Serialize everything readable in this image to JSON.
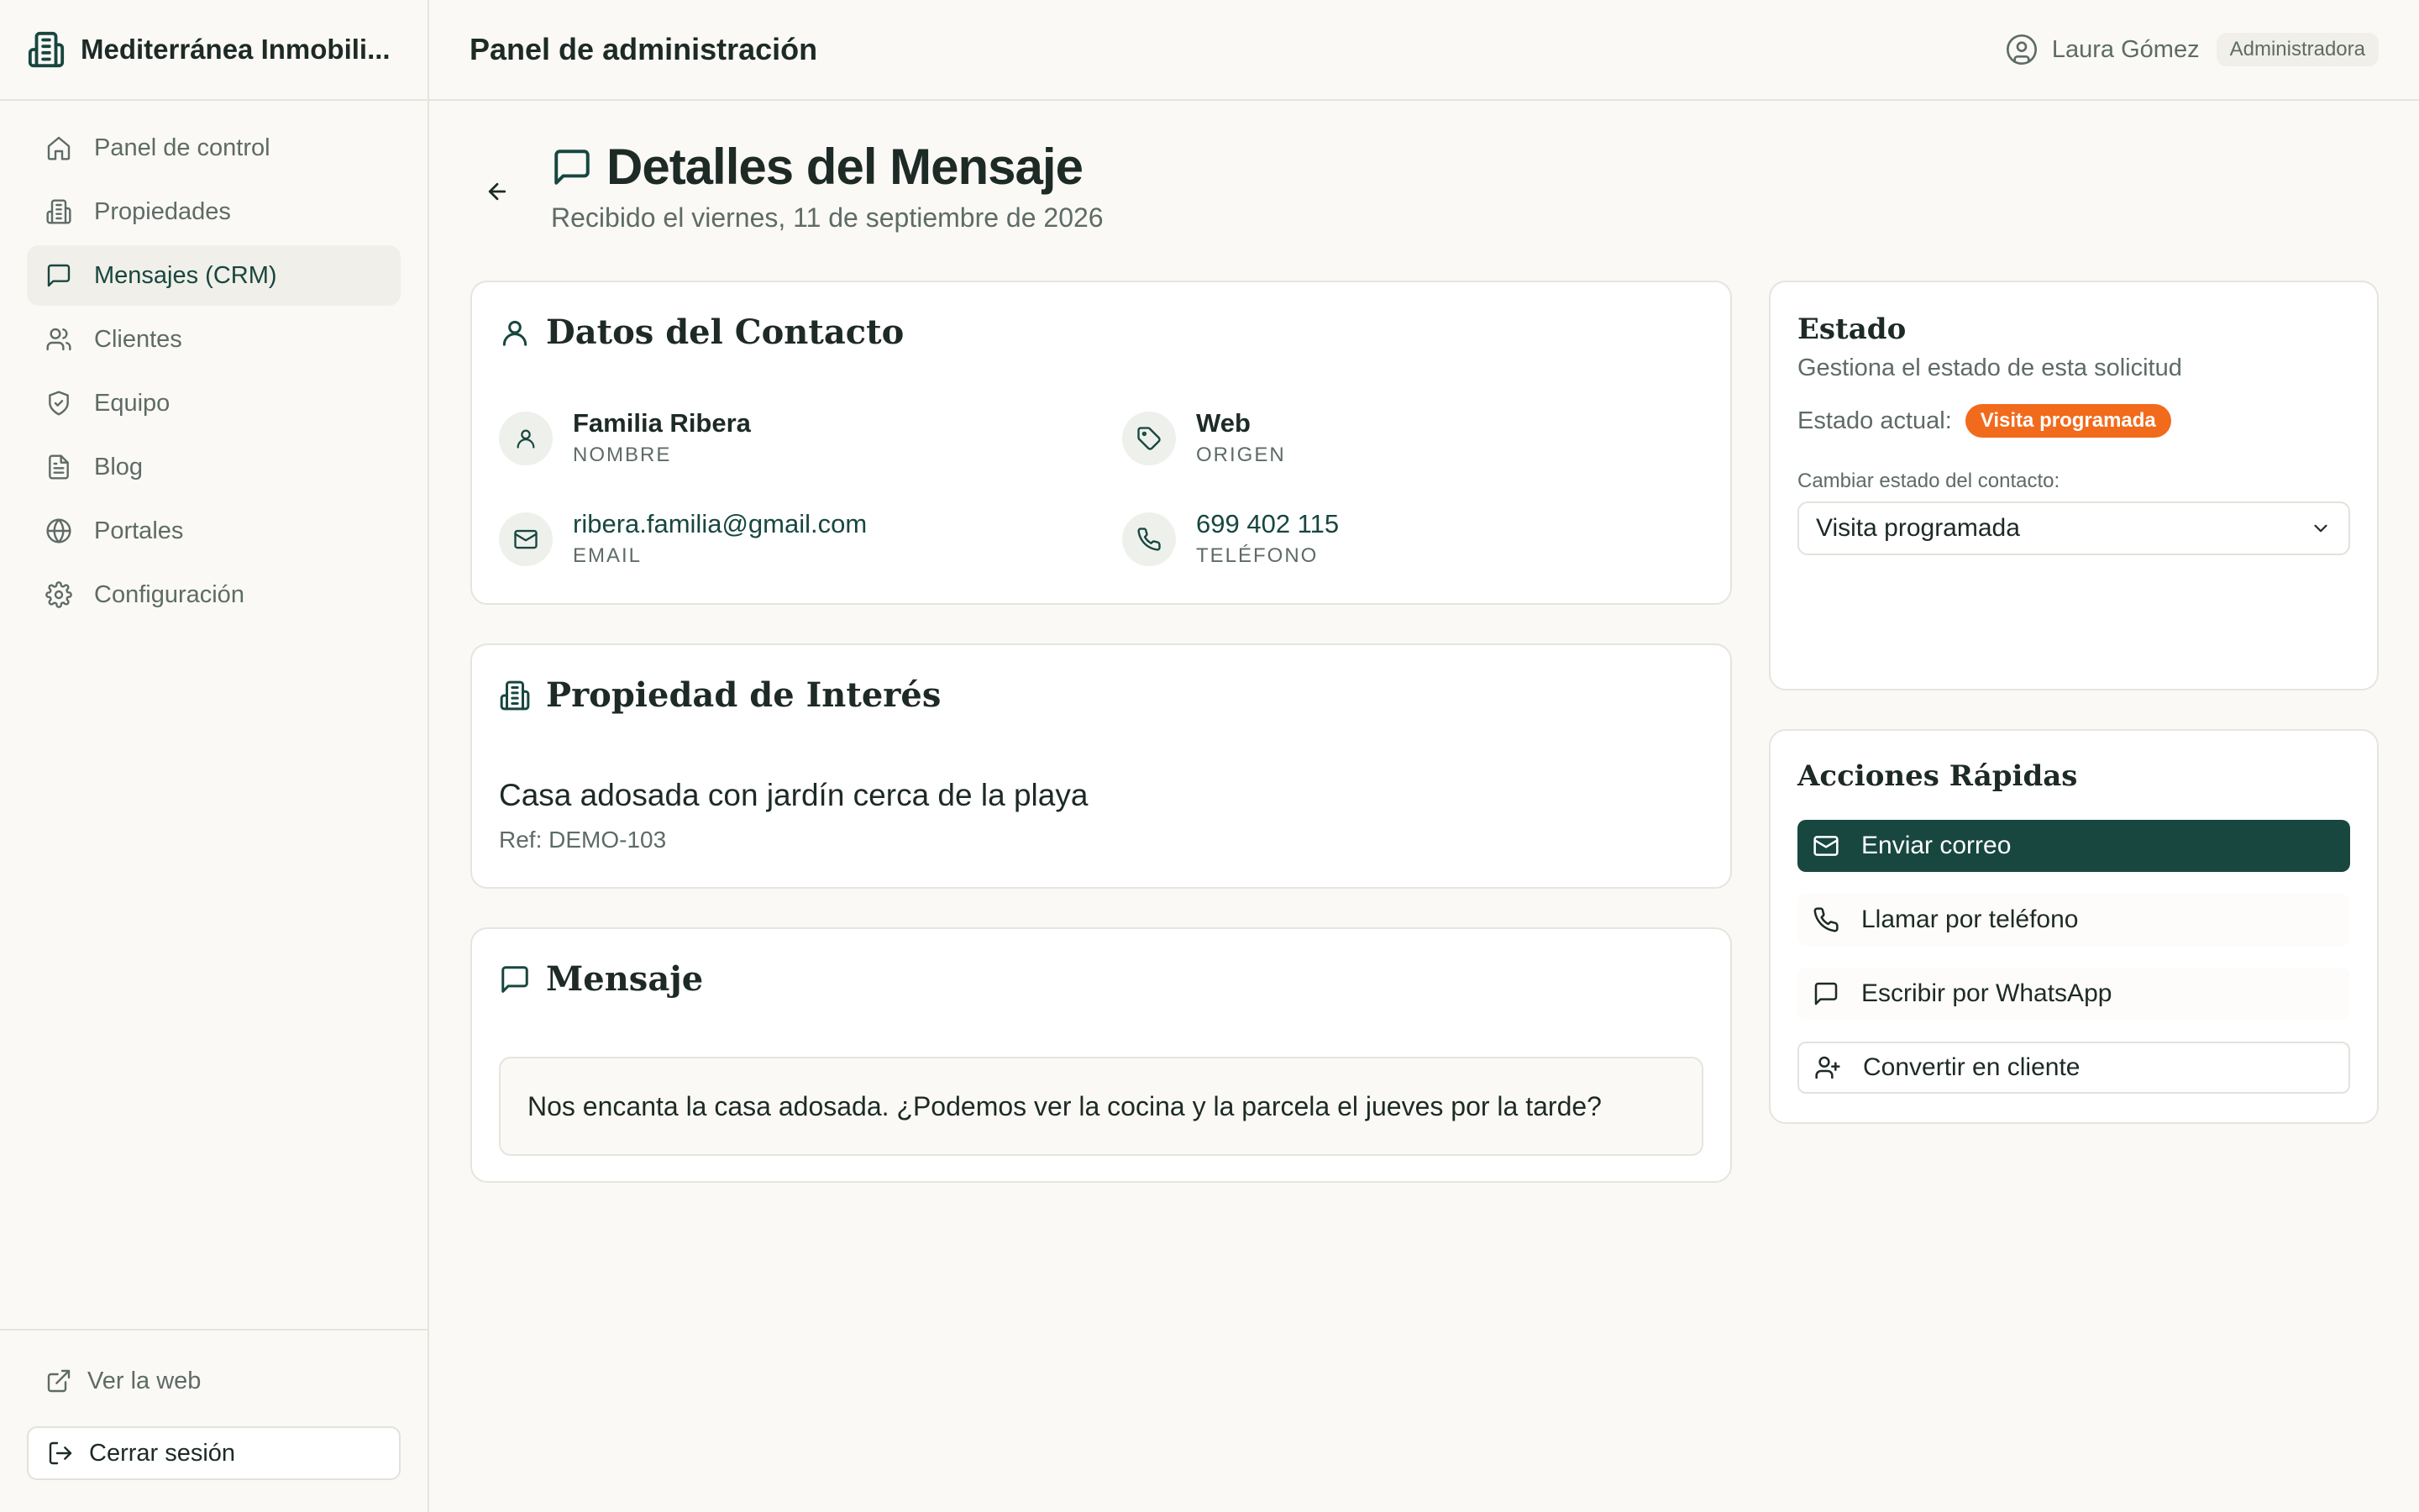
{
  "brand": {
    "name": "Mediterránea Inmobili..."
  },
  "sidebar": {
    "items": [
      {
        "label": "Panel de control",
        "icon": "home-icon"
      },
      {
        "label": "Propiedades",
        "icon": "building-icon"
      },
      {
        "label": "Mensajes (CRM)",
        "icon": "message-icon",
        "active": true
      },
      {
        "label": "Clientes",
        "icon": "users-icon"
      },
      {
        "label": "Equipo",
        "icon": "shield-icon"
      },
      {
        "label": "Blog",
        "icon": "file-text-icon"
      },
      {
        "label": "Portales",
        "icon": "globe-icon"
      },
      {
        "label": "Configuración",
        "icon": "gear-icon"
      }
    ],
    "view_site": "Ver la web",
    "logout": "Cerrar sesión"
  },
  "header": {
    "title": "Panel de administración",
    "user_name": "Laura Gómez",
    "user_role": "Administradora"
  },
  "page": {
    "title": "Detalles del Mensaje",
    "subtitle": "Recibido el viernes, 11 de septiembre de 2026"
  },
  "contact": {
    "title": "Datos del Contacto",
    "name": "Familia Ribera",
    "name_label": "NOMBRE",
    "origin": "Web",
    "origin_label": "ORIGEN",
    "email": "ribera.familia@gmail.com",
    "email_label": "EMAIL",
    "phone": "699 402 115",
    "phone_label": "TELÉFONO"
  },
  "property": {
    "title": "Propiedad de Interés",
    "name": "Casa adosada con jardín cerca de la playa",
    "ref": "Ref: DEMO-103"
  },
  "message": {
    "title": "Mensaje",
    "body": "Nos encanta la casa adosada. ¿Podemos ver la cocina y la parcela el jueves por la tarde?"
  },
  "status": {
    "title": "Estado",
    "subtitle": "Gestiona el estado de esta solicitud",
    "current_label": "Estado actual:",
    "current_value": "Visita programada",
    "current_color": "#f26a1b",
    "change_label": "Cambiar estado del contacto:",
    "selected": "Visita programada"
  },
  "quick_actions": {
    "title": "Acciones Rápidas",
    "send_email": "Enviar correo",
    "call": "Llamar por teléfono",
    "whatsapp": "Escribir por WhatsApp",
    "convert": "Convertir en cliente"
  },
  "colors": {
    "accent": "#17473f",
    "background": "#faf9f6",
    "border": "#e6e4de",
    "status_badge": "#f26a1b"
  }
}
